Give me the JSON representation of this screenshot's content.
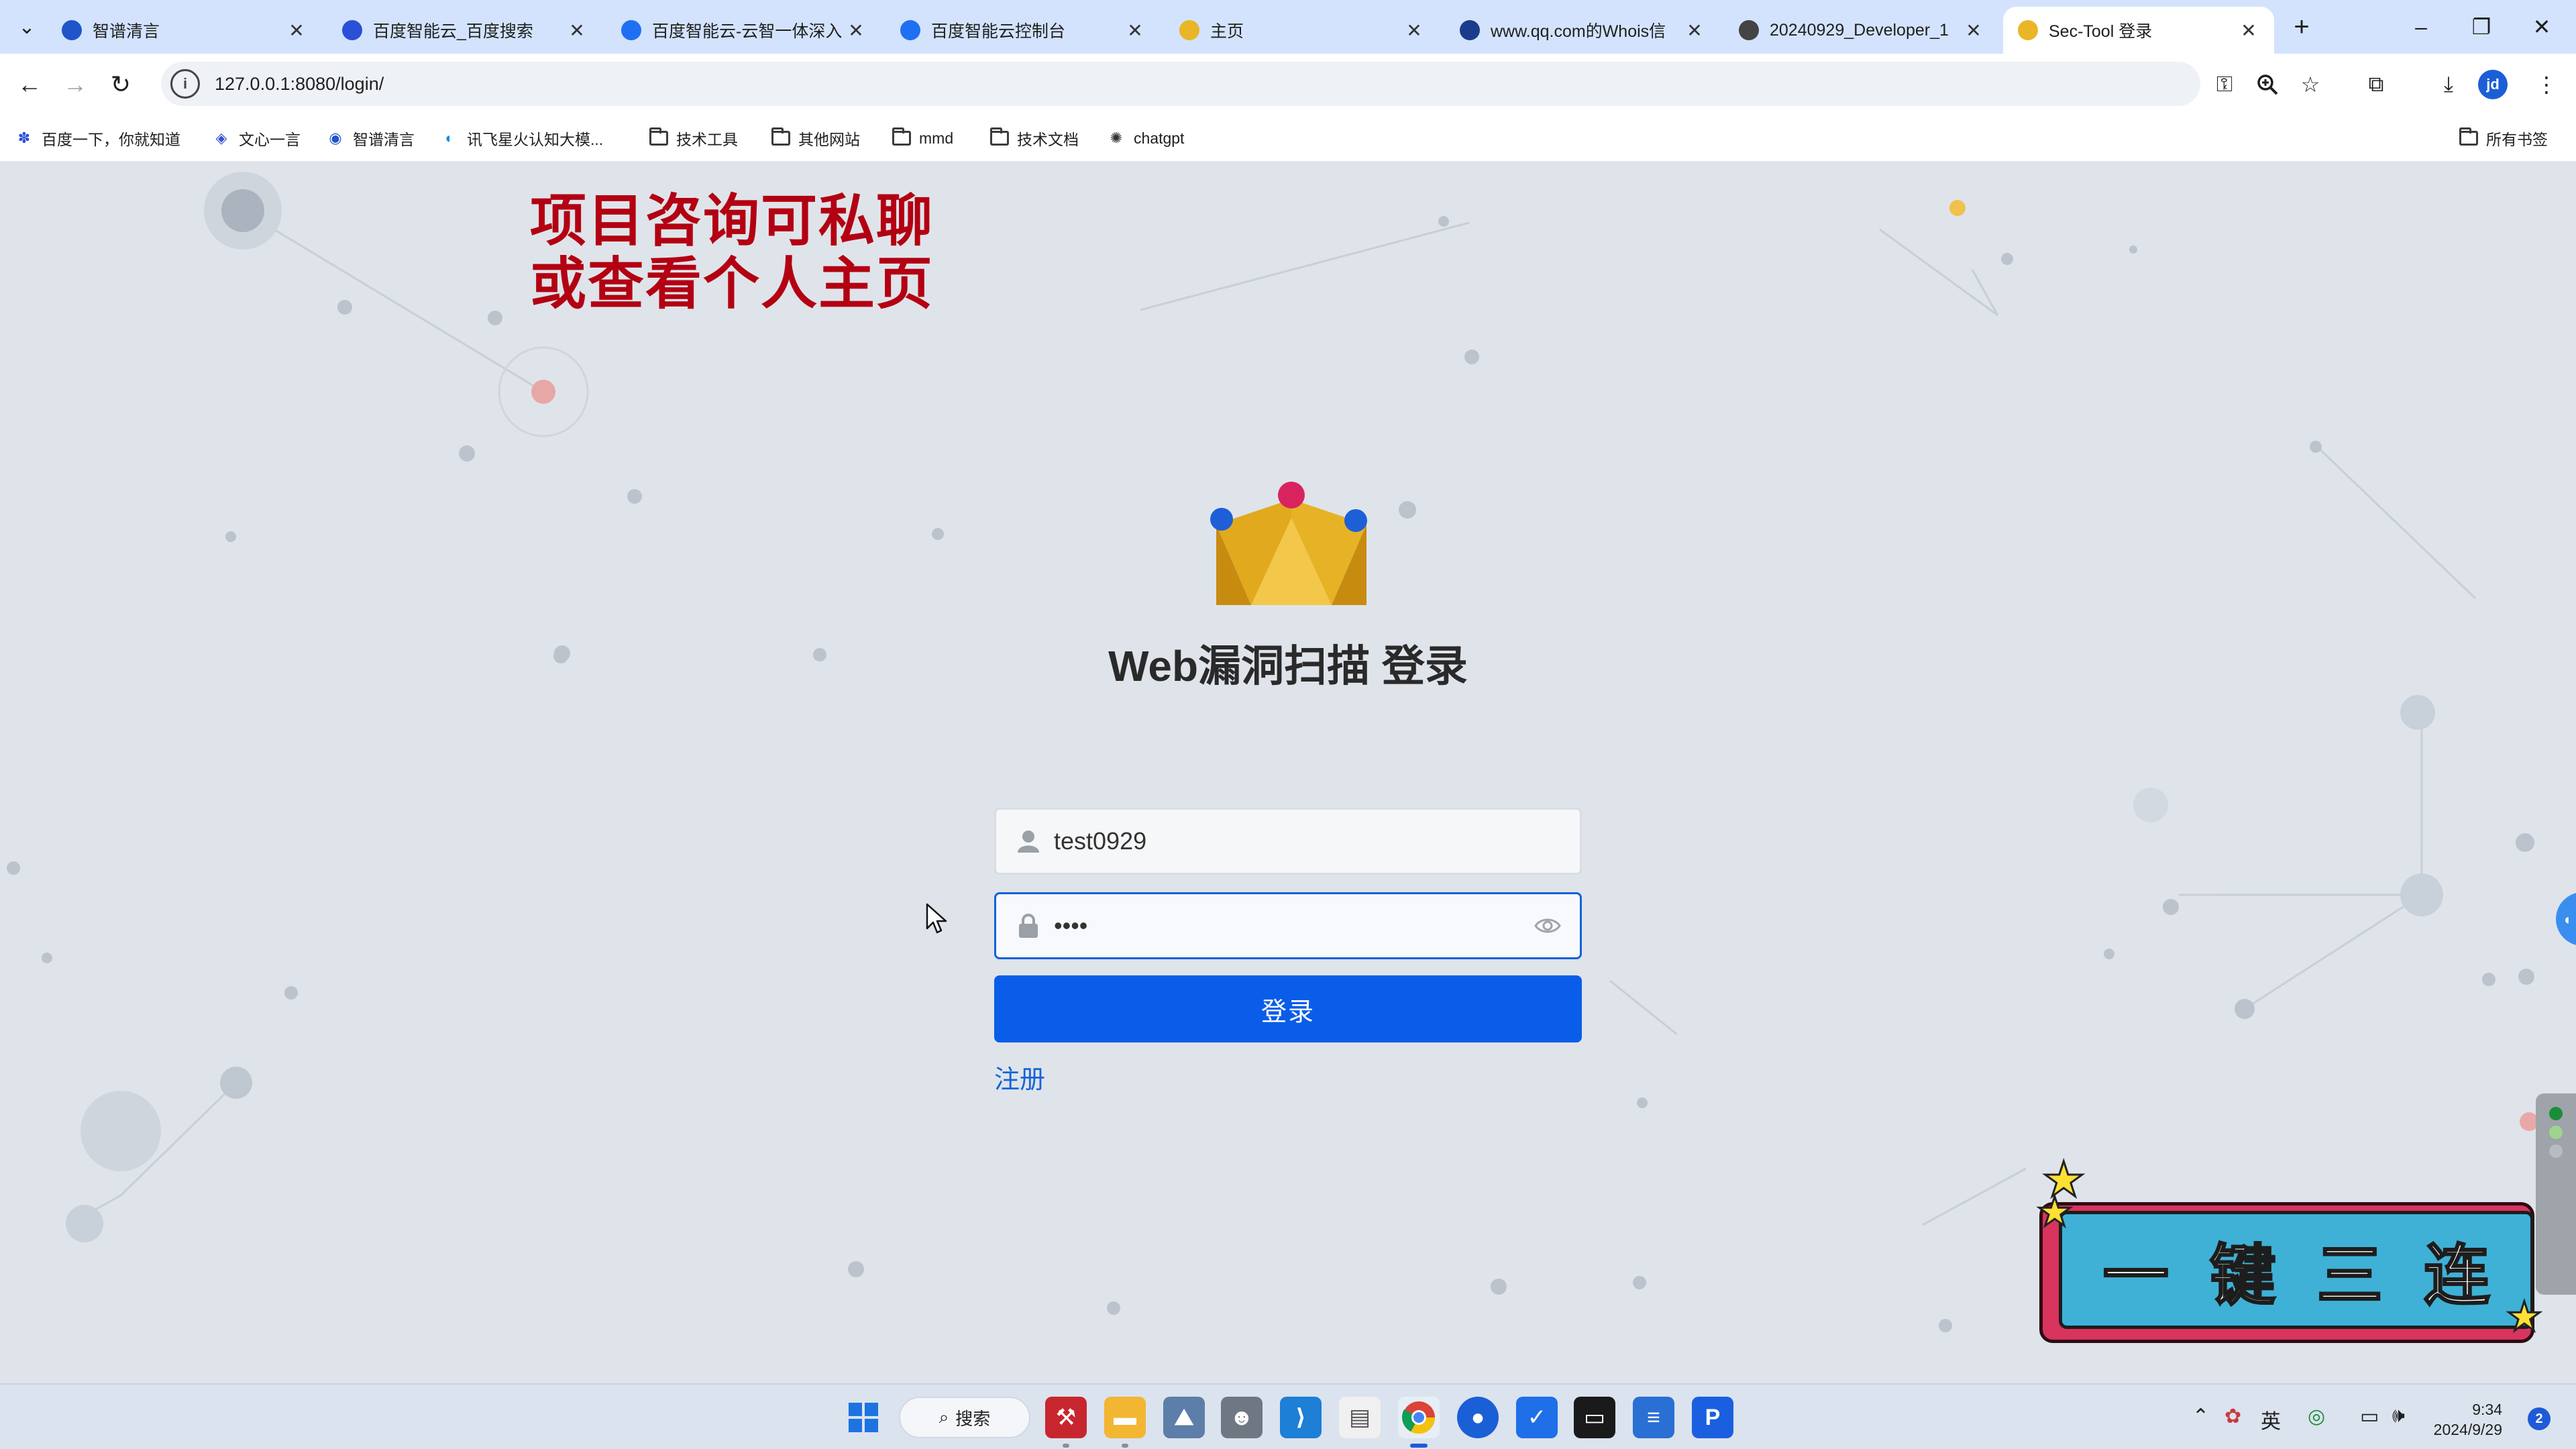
{
  "browser": {
    "tabs": [
      {
        "title": "智谱清言",
        "favicon_color": "#1e55c8",
        "active": false
      },
      {
        "title": "百度智能云_百度搜索",
        "favicon_color": "#2b4fd6",
        "active": false
      },
      {
        "title": "百度智能云-云智一体深入",
        "favicon_color": "#1f6ff2",
        "active": false
      },
      {
        "title": "百度智能云控制台",
        "favicon_color": "#1f6ff2",
        "active": false
      },
      {
        "title": "主页",
        "favicon_color": "#e8b626",
        "active": false
      },
      {
        "title": "www.qq.com的Whois信",
        "favicon_color": "#1b3b8c",
        "active": false
      },
      {
        "title": "20240929_Developer_1",
        "favicon_color": "#444444",
        "active": false
      },
      {
        "title": "Sec-Tool 登录",
        "favicon_color": "#e8b626",
        "active": true
      }
    ],
    "tab_close_glyph": "✕",
    "new_tab_glyph": "+",
    "url": "127.0.0.1:8080/login/",
    "profile_initials": "jd",
    "bookmarks": [
      {
        "label": "百度一下，你就知道",
        "icon": "paw-icon"
      },
      {
        "label": "文心一言",
        "icon": "wenxin-icon"
      },
      {
        "label": "智谱清言",
        "icon": "zhipu-icon"
      },
      {
        "label": "讯飞星火认知大模...",
        "icon": "xinghuo-icon"
      },
      {
        "label": "技术工具",
        "icon": "folder-icon"
      },
      {
        "label": "其他网站",
        "icon": "folder-icon"
      },
      {
        "label": "mmd",
        "icon": "folder-icon"
      },
      {
        "label": "技术文档",
        "icon": "folder-icon"
      },
      {
        "label": "chatgpt",
        "icon": "openai-icon"
      }
    ],
    "all_bookmarks_label": "所有书签"
  },
  "overlay": {
    "promo_line1": "项目咨询可私聊",
    "promo_line2": "或查看个人主页",
    "triple_chars": [
      "一",
      "键",
      "三",
      "连"
    ]
  },
  "login": {
    "title": "Web漏洞扫描 登录",
    "username_value": "test0929",
    "password_value": "1234",
    "submit_label": "登录",
    "register_label": "注册",
    "accent_color": "#0a5de8"
  },
  "taskbar": {
    "search_label": "搜索",
    "time": "9:34",
    "date": "2024/9/29",
    "notification_count": "2"
  }
}
